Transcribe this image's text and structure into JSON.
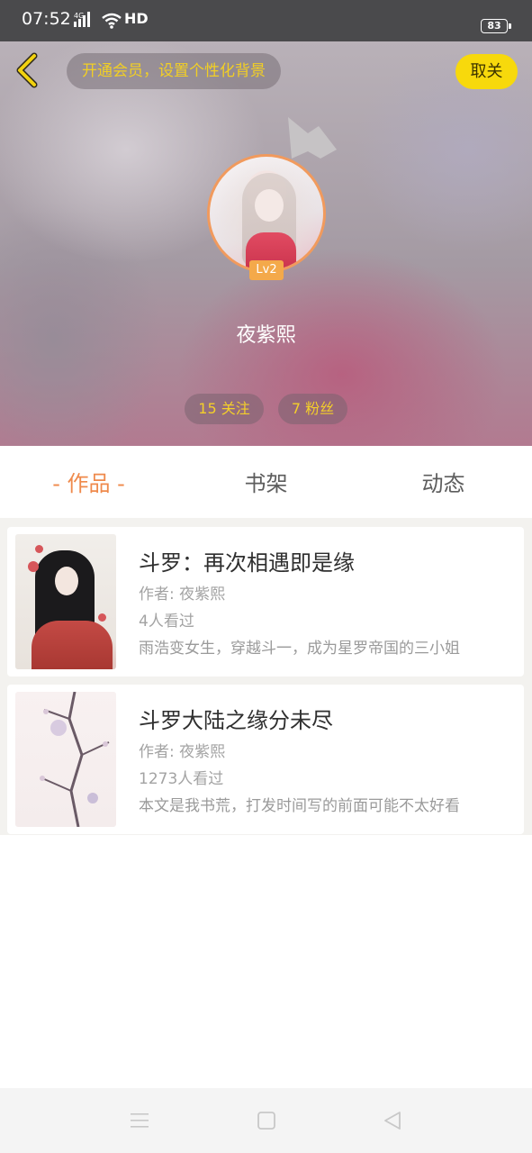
{
  "status_bar": {
    "time": "07:52",
    "network": "4G",
    "hd": "HD",
    "battery": "83"
  },
  "header": {
    "vip_prompt": "开通会员，设置个性化背景",
    "unfollow_label": "取关"
  },
  "profile": {
    "level": "Lv2",
    "username": "夜紫熙",
    "following": "15 关注",
    "fans": "7 粉丝"
  },
  "tabs": [
    {
      "label": "- 作品 -",
      "active": true
    },
    {
      "label": "书架",
      "active": false
    },
    {
      "label": "动态",
      "active": false
    }
  ],
  "books": [
    {
      "title": "斗罗：再次相遇即是缘",
      "author": "作者: 夜紫熙",
      "views": "4人看过",
      "description": "雨浩变女生，穿越斗一，成为星罗帝国的三小姐"
    },
    {
      "title": "斗罗大陆之缘分未尽",
      "author": "作者: 夜紫熙",
      "views": "1273人看过",
      "description": "本文是我书荒，打发时间写的前面可能不太好看"
    }
  ],
  "colors": {
    "accent_orange": "#ef8a4c",
    "vip_yellow": "#f2cf24",
    "unfollow_yellow": "#f7d90c",
    "level_badge": "#f4a94a"
  },
  "icons": [
    "back-arrow-icon",
    "crown-icon",
    "wifi-icon",
    "signal-icon",
    "battery-icon",
    "menu-icon",
    "home-icon",
    "back-triangle-icon"
  ]
}
